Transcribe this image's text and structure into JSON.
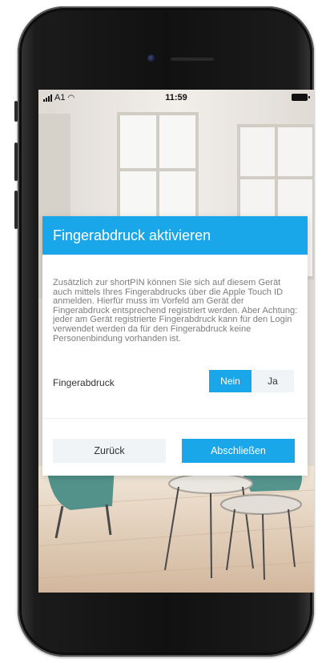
{
  "statusbar": {
    "carrier": "A1",
    "time": "11:59"
  },
  "dialog": {
    "title": "Fingerabdruck aktivieren",
    "body": "Zusätzlich zur shortPIN können Sie sich auf diesem Gerät auch mittels Ihres Fingerabdrucks über die Apple Touch ID anmelden. Hierfür muss im Vorfeld am Gerät der Fingerabdruck entsprechend registriert werden. Aber Achtung: jeder am Gerät registrierte Fingerabdruck kann für den Login verwendet werden da für den Fingerabdruck keine Personenbindung vorhanden ist.",
    "fingerprint_label": "Fingerabdruck",
    "toggle": {
      "options": [
        "Nein",
        "Ja"
      ],
      "selected": "Nein"
    },
    "back_label": "Zurück",
    "finish_label": "Abschließen"
  },
  "colors": {
    "accent": "#19a7ea",
    "button_secondary_bg": "#f1f4f7",
    "body_text": "#7d7d7d"
  },
  "icons": [
    "signal-icon",
    "wifi-icon",
    "battery-icon"
  ]
}
